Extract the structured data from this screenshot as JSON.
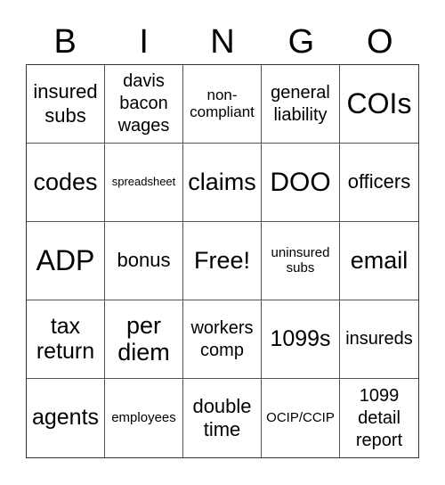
{
  "header": [
    "B",
    "I",
    "N",
    "G",
    "O"
  ],
  "cells": [
    {
      "text": "insured subs",
      "size": "s22"
    },
    {
      "text": "davis bacon wages",
      "size": "s20"
    },
    {
      "text": "non-compliant",
      "size": "s17"
    },
    {
      "text": "general liability",
      "size": "s20"
    },
    {
      "text": "COIs",
      "size": "s32"
    },
    {
      "text": "codes",
      "size": "s27"
    },
    {
      "text": "spreadsheet",
      "size": "s13"
    },
    {
      "text": "claims",
      "size": "s27"
    },
    {
      "text": "DOO",
      "size": "s30"
    },
    {
      "text": "officers",
      "size": "s22"
    },
    {
      "text": "ADP",
      "size": "s32"
    },
    {
      "text": "bonus",
      "size": "s22"
    },
    {
      "text": "Free!",
      "size": "s27"
    },
    {
      "text": "uninsured subs",
      "size": "s15"
    },
    {
      "text": "email",
      "size": "s27"
    },
    {
      "text": "tax return",
      "size": "s25"
    },
    {
      "text": "per diem",
      "size": "s27"
    },
    {
      "text": "workers comp",
      "size": "s20"
    },
    {
      "text": "1099s",
      "size": "s25"
    },
    {
      "text": "insureds",
      "size": "s20"
    },
    {
      "text": "agents",
      "size": "s25"
    },
    {
      "text": "employees",
      "size": "s15"
    },
    {
      "text": "double time",
      "size": "s22"
    },
    {
      "text": "OCIP/CCIP",
      "size": "s15"
    },
    {
      "text": "1099 detail report",
      "size": "s20"
    }
  ]
}
